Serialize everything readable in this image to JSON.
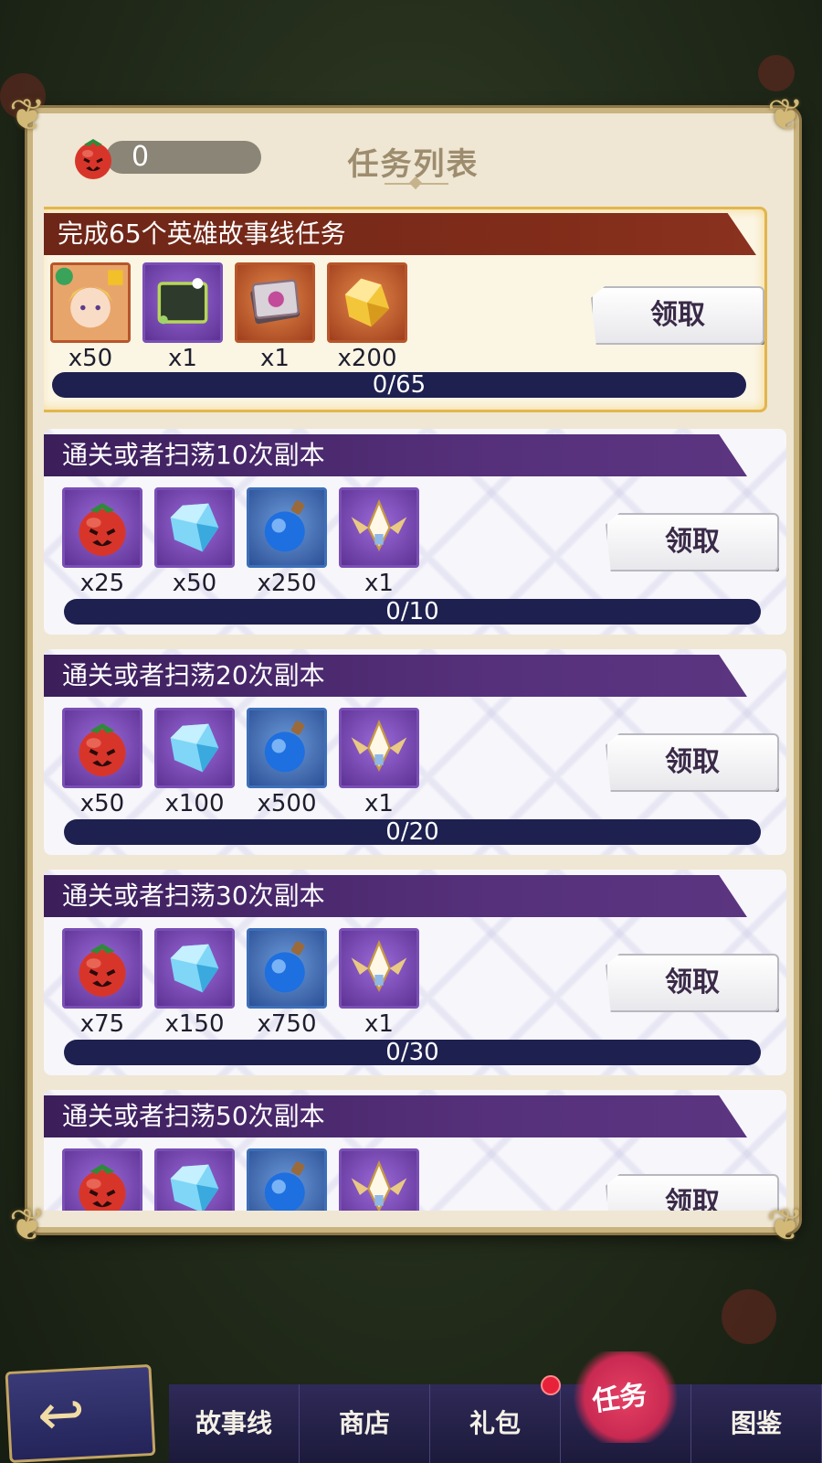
{
  "header": {
    "title": "任务列表",
    "currency_value": "0"
  },
  "tasks": [
    {
      "title": "完成65个英雄故事线任务",
      "style": "gold",
      "rewards": [
        {
          "icon": "hero-portrait-icon",
          "count": "x50",
          "frame": "orange"
        },
        {
          "icon": "picture-frame-icon",
          "count": "x1",
          "frame": "purple"
        },
        {
          "icon": "card-deck-icon",
          "count": "x1",
          "frame": "orange"
        },
        {
          "icon": "gold-crystal-icon",
          "count": "x200",
          "frame": "orange"
        }
      ],
      "claim_label": "领取",
      "progress": "0/65"
    },
    {
      "title": "通关或者扫荡10次副本",
      "style": "purple",
      "rewards": [
        {
          "icon": "tomato-icon",
          "count": "x25",
          "frame": "purple"
        },
        {
          "icon": "blue-gem-icon",
          "count": "x50",
          "frame": "purple"
        },
        {
          "icon": "blue-potion-icon",
          "count": "x250",
          "frame": "blue"
        },
        {
          "icon": "winged-emblem-icon",
          "count": "x1",
          "frame": "purple"
        }
      ],
      "claim_label": "领取",
      "progress": "0/10"
    },
    {
      "title": "通关或者扫荡20次副本",
      "style": "purple",
      "rewards": [
        {
          "icon": "tomato-icon",
          "count": "x50",
          "frame": "purple"
        },
        {
          "icon": "blue-gem-icon",
          "count": "x100",
          "frame": "purple"
        },
        {
          "icon": "blue-potion-icon",
          "count": "x500",
          "frame": "blue"
        },
        {
          "icon": "winged-emblem-icon",
          "count": "x1",
          "frame": "purple"
        }
      ],
      "claim_label": "领取",
      "progress": "0/20"
    },
    {
      "title": "通关或者扫荡30次副本",
      "style": "purple",
      "rewards": [
        {
          "icon": "tomato-icon",
          "count": "x75",
          "frame": "purple"
        },
        {
          "icon": "blue-gem-icon",
          "count": "x150",
          "frame": "purple"
        },
        {
          "icon": "blue-potion-icon",
          "count": "x750",
          "frame": "blue"
        },
        {
          "icon": "winged-emblem-icon",
          "count": "x1",
          "frame": "purple"
        }
      ],
      "claim_label": "领取",
      "progress": "0/30"
    },
    {
      "title": "通关或者扫荡50次副本",
      "style": "purple",
      "rewards": [
        {
          "icon": "tomato-icon",
          "count": "",
          "frame": "purple"
        },
        {
          "icon": "blue-gem-icon",
          "count": "",
          "frame": "purple"
        },
        {
          "icon": "blue-potion-icon",
          "count": "",
          "frame": "blue"
        },
        {
          "icon": "winged-emblem-icon",
          "count": "",
          "frame": "purple"
        }
      ],
      "claim_label": "领取",
      "progress": ""
    }
  ],
  "nav": {
    "tabs": [
      "故事线",
      "商店",
      "礼包",
      "任务",
      "图鉴"
    ],
    "active": "任务"
  },
  "colors": {
    "panel_bg": "#efe7d3",
    "title_bar_purple": "#4a2870",
    "title_bar_red": "#7a2a18",
    "progress_bar": "#1e2050",
    "active_tab": "#c92a52"
  }
}
